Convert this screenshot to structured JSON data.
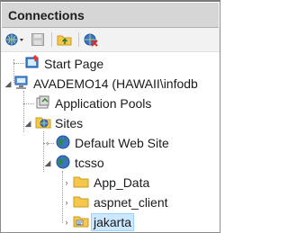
{
  "panel": {
    "title": "Connections"
  },
  "toolbar": {
    "icons": [
      "connect-globe-icon",
      "save-icon",
      "up-folder-icon",
      "delete-connection-icon"
    ]
  },
  "tree": {
    "start_page": "Start Page",
    "server": "AVADEMO14 (HAWAII\\infodb",
    "app_pools": "Application Pools",
    "sites": "Sites",
    "default_site": "Default Web Site",
    "tcsso": "tcsso",
    "app_data": "App_Data",
    "aspnet_client": "aspnet_client",
    "jakarta": "jakarta",
    "selected": "jakarta"
  },
  "colors": {
    "header_bg": "#d6d6d6",
    "selection_bg": "#cce8ff",
    "selection_border": "#99d1ff",
    "folder": "#f5c84c",
    "globe": "#2f8b3a"
  }
}
